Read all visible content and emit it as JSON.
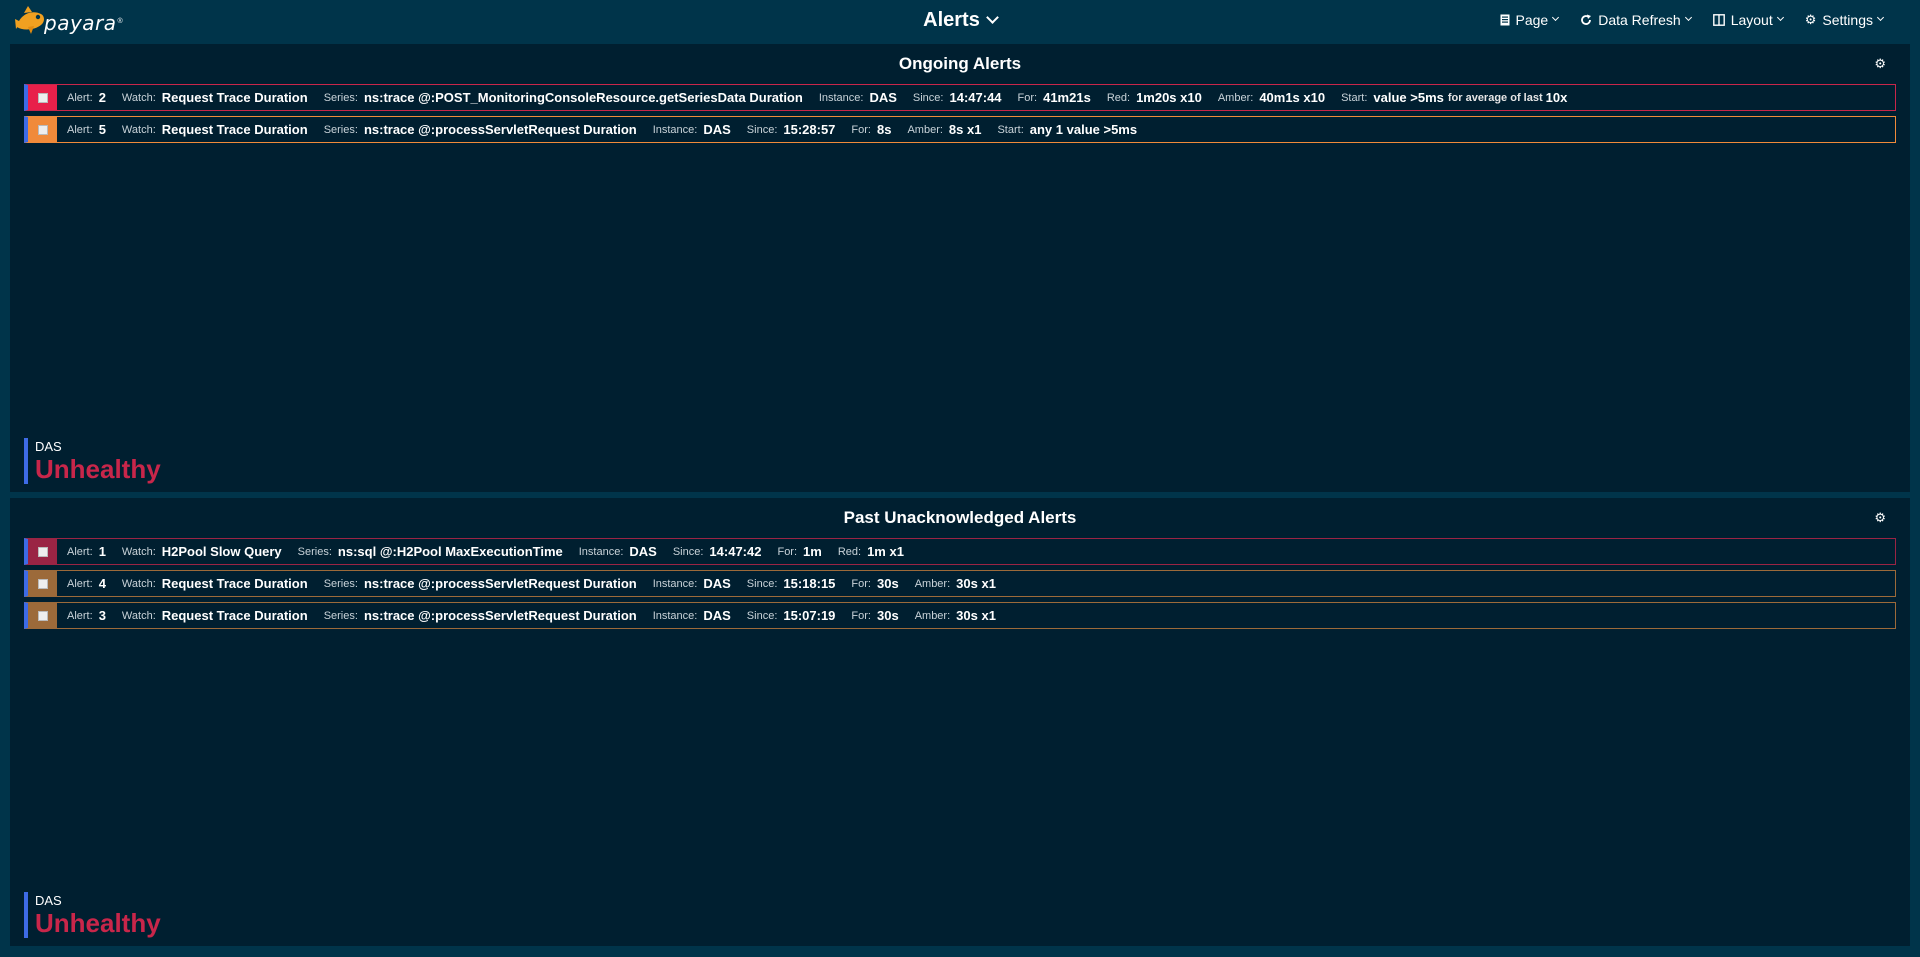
{
  "app": {
    "logo_text": "payara"
  },
  "header": {
    "title": "Alerts",
    "menu": [
      {
        "label": "Page",
        "icon": "page-icon"
      },
      {
        "label": "Data Refresh",
        "icon": "refresh-icon"
      },
      {
        "label": "Layout",
        "icon": "layout-icon"
      },
      {
        "label": "Settings",
        "icon": "gear-icon"
      }
    ]
  },
  "colors": {
    "background": "#00344a",
    "panel": "#001f30",
    "red": "#e8204a",
    "amber": "#f08a3a",
    "ack_red": "#9a2444",
    "ack_amber": "#9c6a3a",
    "instance_bar": "#3e6be6",
    "unhealthy": "#c8264a"
  },
  "ongoing": {
    "title": "Ongoing Alerts",
    "alerts": [
      {
        "alert_label": "Alert:",
        "alert": "2",
        "watch_label": "Watch:",
        "watch": "Request Trace Duration",
        "series_label": "Series:",
        "series": "ns:trace @:POST_MonitoringConsoleResource.getSeriesData Duration",
        "instance_label": "Instance:",
        "instance": "DAS",
        "since_label": "Since:",
        "since": "14:47:44",
        "for_label": "For:",
        "for": "41m21s",
        "red_label": "Red:",
        "red": "1m20s x10",
        "amber_label": "Amber:",
        "amber": "40m1s x10",
        "start_label": "Start:",
        "start": "value >5ms",
        "start_note": "for average of last",
        "start_count": "10x"
      },
      {
        "alert_label": "Alert:",
        "alert": "5",
        "watch_label": "Watch:",
        "watch": "Request Trace Duration",
        "series_label": "Series:",
        "series": "ns:trace @:processServletRequest Duration",
        "instance_label": "Instance:",
        "instance": "DAS",
        "since_label": "Since:",
        "since": "15:28:57",
        "for_label": "For:",
        "for": "8s",
        "amber_label": "Amber:",
        "amber": "8s x1",
        "start_label": "Start:",
        "start": "any 1 value >5ms"
      }
    ],
    "health": {
      "instance": "DAS",
      "status": "Unhealthy"
    }
  },
  "past": {
    "title": "Past Unacknowledged Alerts",
    "alerts": [
      {
        "alert_label": "Alert:",
        "alert": "1",
        "watch_label": "Watch:",
        "watch": "H2Pool Slow Query",
        "series_label": "Series:",
        "series": "ns:sql @:H2Pool MaxExecutionTime",
        "instance_label": "Instance:",
        "instance": "DAS",
        "since_label": "Since:",
        "since": "14:47:42",
        "for_label": "For:",
        "for": "1m",
        "red_label": "Red:",
        "red": "1m x1"
      },
      {
        "alert_label": "Alert:",
        "alert": "4",
        "watch_label": "Watch:",
        "watch": "Request Trace Duration",
        "series_label": "Series:",
        "series": "ns:trace @:processServletRequest Duration",
        "instance_label": "Instance:",
        "instance": "DAS",
        "since_label": "Since:",
        "since": "15:18:15",
        "for_label": "For:",
        "for": "30s",
        "amber_label": "Amber:",
        "amber": "30s x1"
      },
      {
        "alert_label": "Alert:",
        "alert": "3",
        "watch_label": "Watch:",
        "watch": "Request Trace Duration",
        "series_label": "Series:",
        "series": "ns:trace @:processServletRequest Duration",
        "instance_label": "Instance:",
        "instance": "DAS",
        "since_label": "Since:",
        "since": "15:07:19",
        "for_label": "For:",
        "for": "30s",
        "amber_label": "Amber:",
        "amber": "30s x1"
      }
    ],
    "health": {
      "instance": "DAS",
      "status": "Unhealthy"
    }
  }
}
